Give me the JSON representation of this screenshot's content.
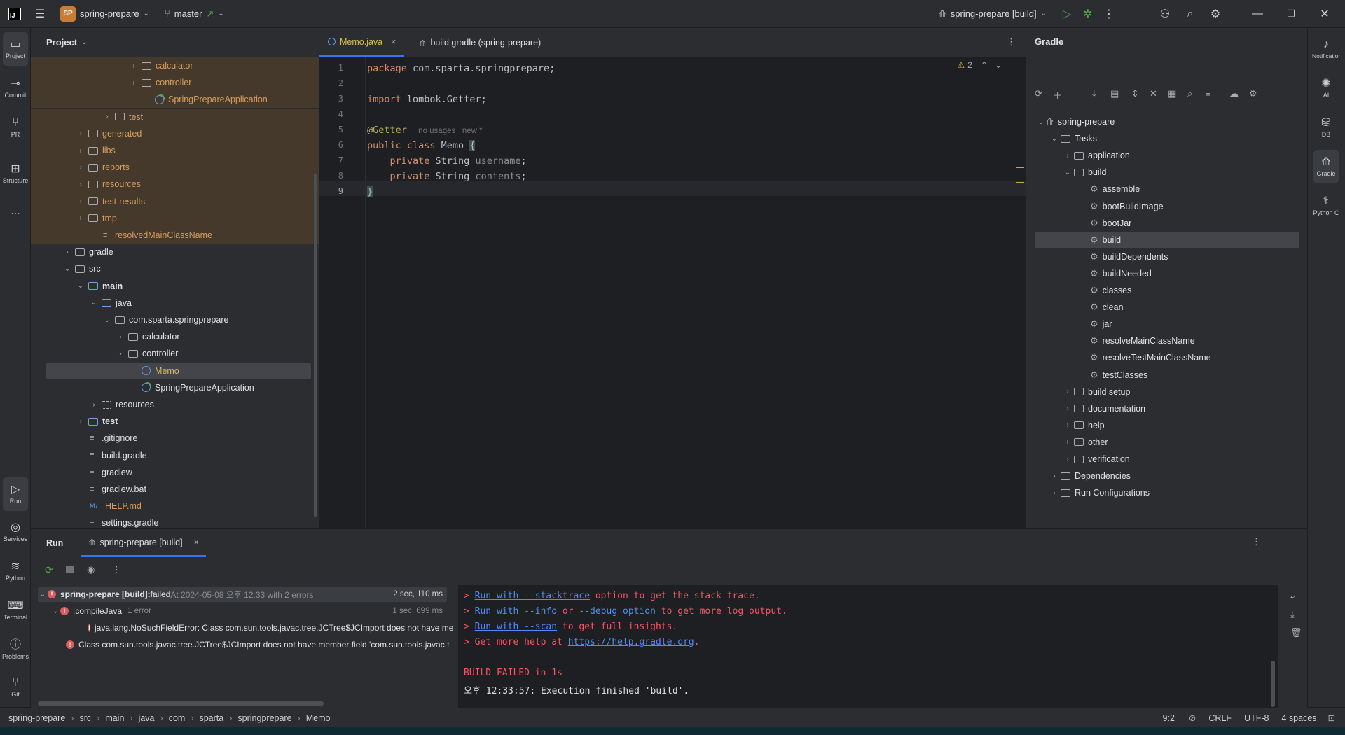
{
  "topbar": {
    "project_badge": "SP",
    "project_name": "spring-prepare",
    "branch": "master",
    "branch_arrow": "↗",
    "run_config": "spring-prepare [build]"
  },
  "leftstrip": {
    "project": "Project",
    "commit": "Commit",
    "pr": "PR",
    "structure": "Structure",
    "more": "...",
    "run": "Run",
    "services": "Services",
    "python": "Python",
    "terminal": "Terminal",
    "problems": "Problems",
    "git": "Git"
  },
  "rightstrip": {
    "notifications": "Notifications",
    "ai": "AI",
    "db": "DB",
    "gradle": "Gradle",
    "python": "Python C"
  },
  "project": {
    "title": "Project",
    "tree": [
      {
        "label": "calculator",
        "depth": 6,
        "kind": "folder",
        "chev": "›",
        "style": "orange",
        "excluded": true
      },
      {
        "label": "controller",
        "depth": 6,
        "kind": "folder",
        "chev": "›",
        "style": "orange",
        "excluded": true
      },
      {
        "label": "SpringPrepareApplication",
        "depth": 7,
        "kind": "spring",
        "chev": "",
        "style": "orange",
        "excluded": true
      },
      {
        "label": "test",
        "depth": 4,
        "kind": "folder",
        "chev": "›",
        "style": "orange",
        "excluded": true
      },
      {
        "label": "generated",
        "depth": 2,
        "kind": "folder",
        "chev": "›",
        "style": "orange",
        "excluded": true
      },
      {
        "label": "libs",
        "depth": 2,
        "kind": "folder",
        "chev": "›",
        "style": "orange",
        "excluded": true
      },
      {
        "label": "reports",
        "depth": 2,
        "kind": "folder",
        "chev": "›",
        "style": "orange",
        "excluded": true
      },
      {
        "label": "resources",
        "depth": 2,
        "kind": "folder",
        "chev": "›",
        "style": "orange",
        "excluded": true
      },
      {
        "label": "test-results",
        "depth": 2,
        "kind": "folder",
        "chev": "›",
        "style": "orange",
        "excluded": true
      },
      {
        "label": "tmp",
        "depth": 2,
        "kind": "folder",
        "chev": "›",
        "style": "orange",
        "excluded": true
      },
      {
        "label": "resolvedMainClassName",
        "depth": 3,
        "kind": "file",
        "chev": "",
        "style": "orange",
        "excluded": true
      },
      {
        "label": "gradle",
        "depth": 1,
        "kind": "folder",
        "chev": "›",
        "style": "",
        "excluded": false
      },
      {
        "label": "src",
        "depth": 1,
        "kind": "folder",
        "chev": "⌄",
        "style": "",
        "excluded": false
      },
      {
        "label": "main",
        "depth": 2,
        "kind": "src",
        "chev": "⌄",
        "style": "bold",
        "excluded": false
      },
      {
        "label": "java",
        "depth": 3,
        "kind": "src",
        "chev": "⌄",
        "style": "",
        "excluded": false
      },
      {
        "label": "com.sparta.springprepare",
        "depth": 4,
        "kind": "folder",
        "chev": "⌄",
        "style": "",
        "excluded": false
      },
      {
        "label": "calculator",
        "depth": 5,
        "kind": "folder",
        "chev": "›",
        "style": "",
        "excluded": false
      },
      {
        "label": "controller",
        "depth": 5,
        "kind": "folder",
        "chev": "›",
        "style": "",
        "excluded": false
      },
      {
        "label": "Memo",
        "depth": 6,
        "kind": "class",
        "chev": "",
        "style": "yellow",
        "excluded": false,
        "selected": true
      },
      {
        "label": "SpringPrepareApplication",
        "depth": 6,
        "kind": "spring",
        "chev": "",
        "style": "",
        "excluded": false
      },
      {
        "label": "resources",
        "depth": 3,
        "kind": "res",
        "chev": "›",
        "style": "",
        "excluded": false
      },
      {
        "label": "test",
        "depth": 2,
        "kind": "src",
        "chev": "›",
        "style": "bold",
        "excluded": false
      },
      {
        "label": ".gitignore",
        "depth": 2,
        "kind": "file",
        "chev": "",
        "style": "",
        "excluded": false
      },
      {
        "label": "build.gradle",
        "depth": 2,
        "kind": "file",
        "chev": "",
        "style": "",
        "excluded": false
      },
      {
        "label": "gradlew",
        "depth": 2,
        "kind": "file",
        "chev": "",
        "style": "",
        "excluded": false
      },
      {
        "label": "gradlew.bat",
        "depth": 2,
        "kind": "file",
        "chev": "",
        "style": "",
        "excluded": false
      },
      {
        "label": "HELP.md",
        "depth": 2,
        "kind": "md",
        "chev": "",
        "style": "orange",
        "excluded": false
      },
      {
        "label": "settings.gradle",
        "depth": 2,
        "kind": "file",
        "chev": "",
        "style": "",
        "excluded": false
      }
    ]
  },
  "editor": {
    "tabs": [
      {
        "label": "Memo.java",
        "close": "×"
      },
      {
        "label": "build.gradle (spring-prepare)",
        "close": ""
      }
    ],
    "warnings": "2",
    "lines": [
      "1",
      "2",
      "3",
      "4",
      "5",
      "6",
      "7",
      "8",
      "9"
    ],
    "code": {
      "l1_kw": "package",
      "l1_rest": " com.sparta.springprepare;",
      "l3_kw": "import",
      "l3_rest": " lombok.Getter;",
      "l5_ann": "@Getter",
      "l5_hint": "no usages   new *",
      "l6_kw": "public class",
      "l6_rest": " Memo ",
      "l6_brace": "{",
      "l7_kw": "    private",
      "l7_type": " String ",
      "l7_field": "username",
      "l7_end": ";",
      "l8_kw": "    private",
      "l8_type": " String ",
      "l8_field": "contents",
      "l8_end": ";",
      "l9": "}"
    }
  },
  "gradle": {
    "title": "Gradle",
    "tree": [
      {
        "label": "spring-prepare",
        "depth": 0,
        "chev": "⌄",
        "kind": "project"
      },
      {
        "label": "Tasks",
        "depth": 1,
        "chev": "⌄",
        "kind": "folder"
      },
      {
        "label": "application",
        "depth": 2,
        "chev": "›",
        "kind": "folder"
      },
      {
        "label": "build",
        "depth": 2,
        "chev": "⌄",
        "kind": "folder"
      },
      {
        "label": "assemble",
        "depth": 3,
        "chev": "",
        "kind": "task"
      },
      {
        "label": "bootBuildImage",
        "depth": 3,
        "chev": "",
        "kind": "task"
      },
      {
        "label": "bootJar",
        "depth": 3,
        "chev": "",
        "kind": "task"
      },
      {
        "label": "build",
        "depth": 3,
        "chev": "",
        "kind": "task",
        "selected": true
      },
      {
        "label": "buildDependents",
        "depth": 3,
        "chev": "",
        "kind": "task"
      },
      {
        "label": "buildNeeded",
        "depth": 3,
        "chev": "",
        "kind": "task"
      },
      {
        "label": "classes",
        "depth": 3,
        "chev": "",
        "kind": "task"
      },
      {
        "label": "clean",
        "depth": 3,
        "chev": "",
        "kind": "task"
      },
      {
        "label": "jar",
        "depth": 3,
        "chev": "",
        "kind": "task"
      },
      {
        "label": "resolveMainClassName",
        "depth": 3,
        "chev": "",
        "kind": "task"
      },
      {
        "label": "resolveTestMainClassName",
        "depth": 3,
        "chev": "",
        "kind": "task"
      },
      {
        "label": "testClasses",
        "depth": 3,
        "chev": "",
        "kind": "task"
      },
      {
        "label": "build setup",
        "depth": 2,
        "chev": "›",
        "kind": "folder"
      },
      {
        "label": "documentation",
        "depth": 2,
        "chev": "›",
        "kind": "folder"
      },
      {
        "label": "help",
        "depth": 2,
        "chev": "›",
        "kind": "folder"
      },
      {
        "label": "other",
        "depth": 2,
        "chev": "›",
        "kind": "folder"
      },
      {
        "label": "verification",
        "depth": 2,
        "chev": "›",
        "kind": "folder"
      },
      {
        "label": "Dependencies",
        "depth": 1,
        "chev": "›",
        "kind": "folder"
      },
      {
        "label": "Run Configurations",
        "depth": 1,
        "chev": "›",
        "kind": "folder"
      }
    ]
  },
  "run": {
    "tab_run": "Run",
    "tab_config": "spring-prepare [build]",
    "tree": {
      "r1_label": "spring-prepare [build]:",
      "r1_status": " failed",
      "r1_detail": " At 2024-05-08 오후 12:33 with 2 errors",
      "r1_time": "2 sec, 110 ms",
      "r2_label": ":compileJava",
      "r2_detail": "1 error",
      "r2_time": "1 sec, 699 ms",
      "r3_label": "java.lang.NoSuchFieldError: Class com.sun.tools.javac.tree.JCTree$JCImport does not have men",
      "r4_label": "Class com.sun.tools.javac.tree.JCTree$JCImport does not have member field 'com.sun.tools.javac.t"
    },
    "console": {
      "c1_a": "> ",
      "c1_link": "Run with --stacktrace",
      "c1_b": " option to get the stack trace.",
      "c2_a": "> ",
      "c2_link1": "Run with --info",
      "c2_b": " or ",
      "c2_link2": "--debug option",
      "c2_c": " to get more log output.",
      "c3_a": "> ",
      "c3_link": "Run with --scan",
      "c3_b": " to get full insights.",
      "c4_a": "> Get more help at ",
      "c4_link": "https://help.gradle.org",
      "c4_b": ".",
      "c5": "BUILD FAILED in 1s",
      "c6": "오후 12:33:57: Execution finished 'build'."
    }
  },
  "statusbar": {
    "crumbs": [
      "spring-prepare",
      "src",
      "main",
      "java",
      "com",
      "sparta",
      "springprepare",
      "Memo"
    ],
    "separator": "›",
    "position": "9:2",
    "line_ending": "CRLF",
    "encoding": "UTF-8",
    "indent": "4 spaces"
  }
}
